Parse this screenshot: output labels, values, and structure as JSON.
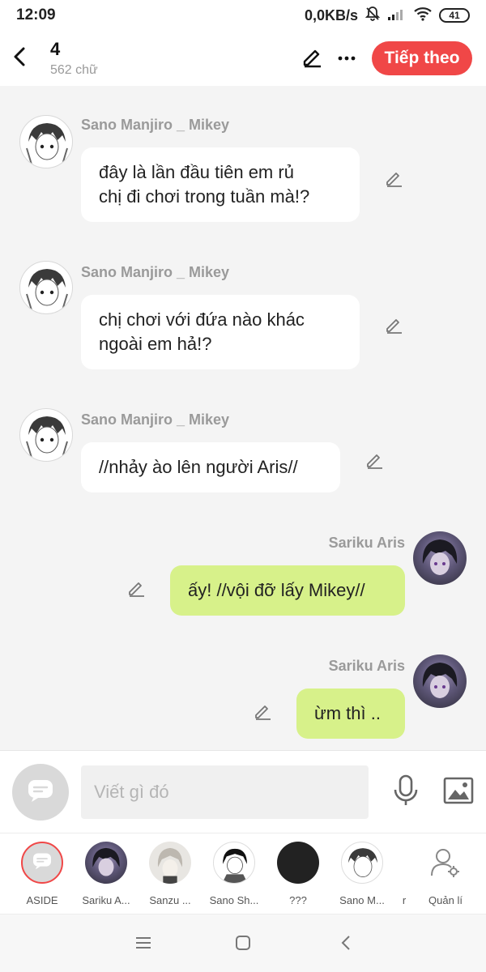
{
  "status": {
    "time": "12:09",
    "speed": "0,0KB/s",
    "battery": "41"
  },
  "header": {
    "title": "4",
    "subtitle": "562 chữ",
    "next_label": "Tiếp theo"
  },
  "messages": [
    {
      "sender": "Sano Manjiro _ Mikey",
      "lines": [
        "đây là lần đầu tiên em rủ",
        "chị đi chơi trong tuần mà!?"
      ]
    },
    {
      "sender": "Sano Manjiro _ Mikey",
      "lines": [
        "chị chơi với đứa nào khác",
        "ngoài em hả!?"
      ]
    },
    {
      "sender": "Sano Manjiro _ Mikey",
      "lines": [
        "//nhảy ào lên người Aris//"
      ]
    },
    {
      "sender": "Sariku Aris",
      "lines": [
        "ấy! //vội đỡ lấy Mikey//"
      ]
    },
    {
      "sender": "Sariku Aris",
      "lines": [
        "ừm thì .."
      ]
    }
  ],
  "input": {
    "placeholder": "Viết gì đó"
  },
  "characters": [
    {
      "label": "ASIDE"
    },
    {
      "label": "Sariku A..."
    },
    {
      "label": "Sanzu ..."
    },
    {
      "label": "Sano Sh..."
    },
    {
      "label": "???"
    },
    {
      "label": "Sano M..."
    },
    {
      "label": "r"
    },
    {
      "label": "Quản lí"
    }
  ],
  "colors": {
    "accent": "#f04747",
    "bubble_other": "#ffffff",
    "bubble_self": "#d7f18a"
  },
  "icons": [
    "back-arrow-icon",
    "edit-icon",
    "more-icon",
    "pencil-icon",
    "message-icon",
    "mic-icon",
    "image-icon",
    "user-settings-icon",
    "menu-icon",
    "home-icon",
    "nav-back-icon"
  ]
}
